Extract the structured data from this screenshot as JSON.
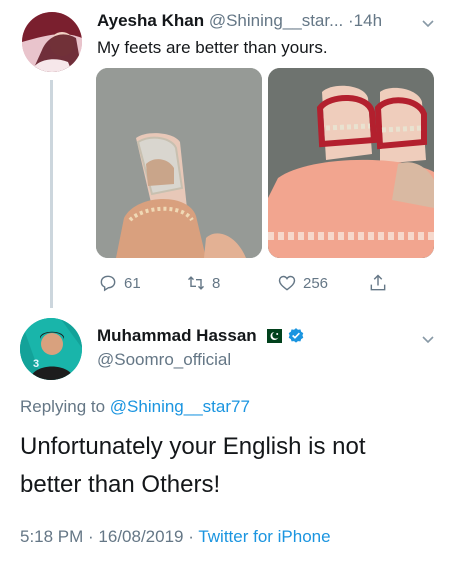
{
  "tweet1": {
    "display_name": "Ayesha Khan",
    "handle": "@Shining__star...",
    "dot": "·",
    "time": "14h",
    "text": "My feets are better than yours.",
    "actions": {
      "replies": "61",
      "retweets": "8",
      "likes": "256"
    }
  },
  "tweet2": {
    "display_name": "Muhammad Hassan",
    "handle": "@Soomro_official",
    "replying_prefix": "Replying to",
    "replying_handle": "@Shining__star77",
    "text_line1": "Unfortunately your English is not",
    "text_line2": "better than Others!",
    "timestamp": "5:18 PM · 16/08/2019 ·",
    "source": "Twitter for iPhone",
    "avatar_badge": "3"
  },
  "colors": {
    "accent": "#1b95e0",
    "muted": "#657786",
    "text": "#14171a",
    "thread_line": "#ccd6dd",
    "flag_green": "#01411c"
  },
  "icons": [
    "reply-icon",
    "retweet-icon",
    "like-icon",
    "share-icon",
    "chevron-down-icon",
    "verified-badge-icon",
    "pakistan-flag-icon"
  ]
}
